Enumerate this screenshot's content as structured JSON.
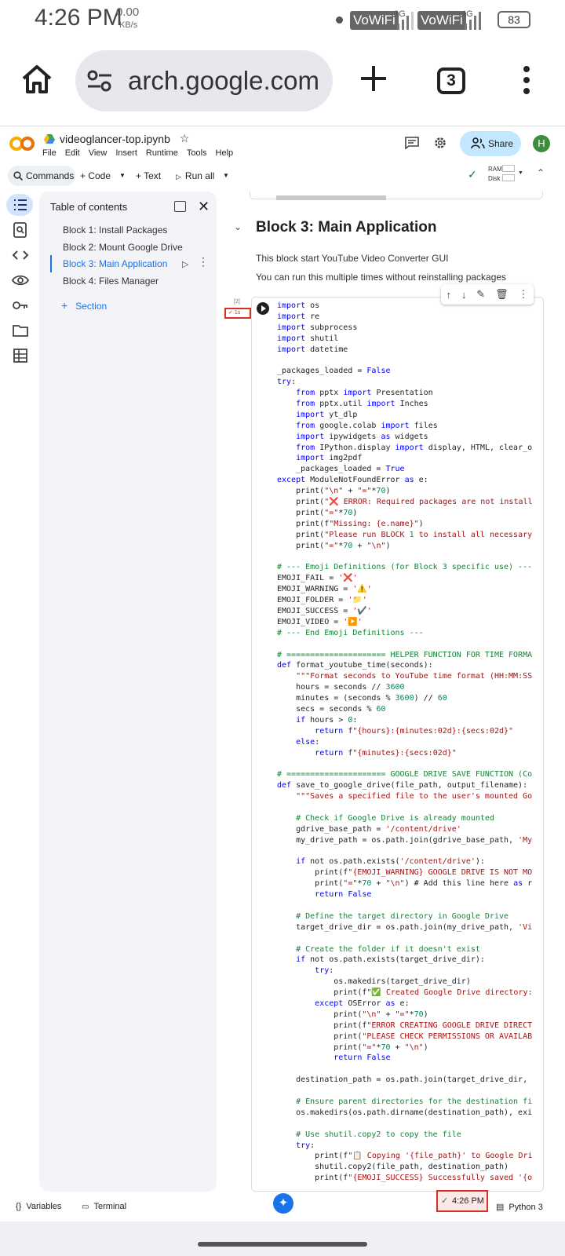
{
  "status_bar": {
    "time": "4:26 PM",
    "speed": "0.00",
    "speed_unit": "KB/s",
    "vowifi": "VoWiFi",
    "net1": "3G",
    "net2": "4G",
    "battery": "83"
  },
  "browser": {
    "url": "arch.google.com",
    "tab_count": "3"
  },
  "colab": {
    "notebook_name": "videoglancer-top.ipynb",
    "menu": [
      "File",
      "Edit",
      "View",
      "Insert",
      "Runtime",
      "Tools",
      "Help"
    ],
    "share_label": "Share",
    "avatar_letter": "H",
    "toolbar": {
      "commands": "Commands",
      "code": "+ Code",
      "text": "+ Text",
      "run_all": "Run all"
    },
    "resources": {
      "ram": "RAM",
      "disk": "Disk"
    }
  },
  "toc": {
    "title": "Table of contents",
    "items": [
      "Block 1: Install Packages",
      "Block 2: Mount Google Drive",
      "Block 3: Main Application",
      "Block 4: Files Manager"
    ],
    "add_section": "Section"
  },
  "section": {
    "title": "Block 3: Main Application",
    "desc1": "This block start YouTube Video Converter GUI",
    "desc2": "You can run this multiple times without reinstalling packages"
  },
  "cell": {
    "exec_count": "[2]",
    "exec_time": "1s"
  },
  "code_lines": [
    "import os",
    "import re",
    "import subprocess",
    "import shutil",
    "import datetime",
    "",
    "_packages_loaded = False",
    "try:",
    "    from pptx import Presentation",
    "    from pptx.util import Inches",
    "    import yt_dlp",
    "    from google.colab import files",
    "    import ipywidgets as widgets",
    "    from IPython.display import display, HTML, clear_o",
    "    import img2pdf",
    "    _packages_loaded = True",
    "except ModuleNotFoundError as e:",
    "    print(\"\\n\" + \"=\"*70)",
    "    print(\"❌ ERROR: Required packages are not install",
    "    print(\"=\"*70)",
    "    print(f\"Missing: {e.name}\")",
    "    print(\"Please run BLOCK 1 to install all necessary",
    "    print(\"=\"*70 + \"\\n\")",
    "",
    "# --- Emoji Definitions (for Block 3 specific use) ---",
    "EMOJI_FAIL = '❌'",
    "EMOJI_WARNING = '⚠️'",
    "EMOJI_FOLDER = '📁'",
    "EMOJI_SUCCESS = '✔️'",
    "EMOJI_VIDEO = '▶️'",
    "# --- End Emoji Definitions ---",
    "",
    "# ===================== HELPER FUNCTION FOR TIME FORMA",
    "def format_youtube_time(seconds):",
    "    \"\"\"Format seconds to YouTube time format (HH:MM:SS",
    "    hours = seconds // 3600",
    "    minutes = (seconds % 3600) // 60",
    "    secs = seconds % 60",
    "    if hours > 0:",
    "        return f\"{hours}:{minutes:02d}:{secs:02d}\"",
    "    else:",
    "        return f\"{minutes}:{secs:02d}\"",
    "",
    "# ===================== GOOGLE DRIVE SAVE FUNCTION (Co",
    "def save_to_google_drive(file_path, output_filename):",
    "    \"\"\"Saves a specified file to the user's mounted Go",
    "",
    "    # Check if Google Drive is already mounted",
    "    gdrive_base_path = '/content/drive'",
    "    my_drive_path = os.path.join(gdrive_base_path, 'My",
    "",
    "    if not os.path.exists('/content/drive'):",
    "        print(f\"{EMOJI_WARNING} GOOGLE DRIVE IS NOT MO",
    "        print(\"=\"*70 + \"\\n\") # Add this line here as r",
    "        return False",
    "",
    "    # Define the target directory in Google Drive",
    "    target_drive_dir = os.path.join(my_drive_path, 'Vi",
    "",
    "    # Create the folder if it doesn't exist",
    "    if not os.path.exists(target_drive_dir):",
    "        try:",
    "            os.makedirs(target_drive_dir)",
    "            print(f\"✅ Created Google Drive directory:",
    "        except OSError as e:",
    "            print(\"\\n\" + \"=\"*70)",
    "            print(f\"ERROR CREATING GOOGLE DRIVE DIRECT",
    "            print(\"PLEASE CHECK PERMISSIONS OR AVAILAB",
    "            print(\"=\"*70 + \"\\n\")",
    "            return False",
    "",
    "    destination_path = os.path.join(target_drive_dir, ",
    "",
    "    # Ensure parent directories for the destination fi",
    "    os.makedirs(os.path.dirname(destination_path), exi",
    "",
    "    # Use shutil.copy2 to copy the file",
    "    try:",
    "        print(f\"📋 Copying '{file_path}' to Google Dri",
    "        shutil.copy2(file_path, destination_path)",
    "        print(f\"{EMOJI_SUCCESS} Successfully saved '{o"
  ],
  "bottom": {
    "variables": "Variables",
    "terminal": "Terminal",
    "time": "4:26 PM",
    "runtime": "Python 3"
  },
  "colors": {
    "accent": "#1a73e8",
    "share_bg": "#c2e7ff",
    "error": "#d93025",
    "success": "#188038"
  }
}
